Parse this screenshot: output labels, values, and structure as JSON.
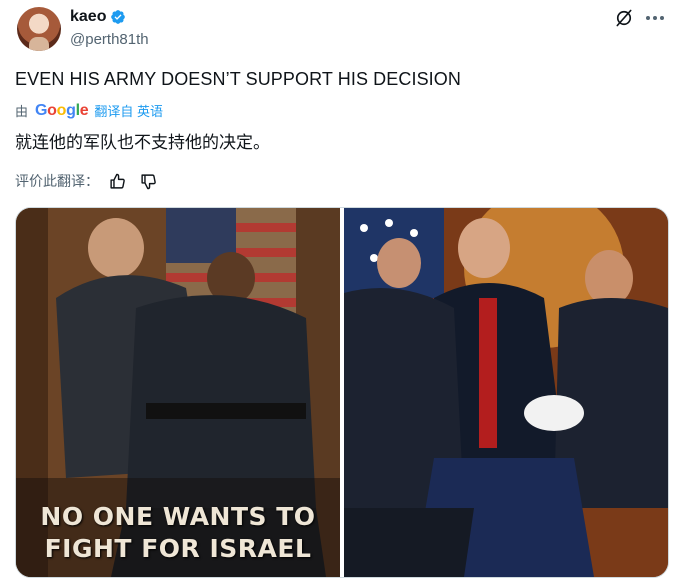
{
  "post": {
    "display_name": "kaeo",
    "handle": "@perth81th",
    "text": "EVEN HIS ARMY DOESN’T SUPPORT HIS DECISION",
    "translated_by_prefix": "由",
    "google_logo": "Google",
    "translated_by_suffix": "翻译自 英语",
    "translated_text": "就连他的军队也不支持他的决定。",
    "rate_label": "评价此翻译："
  },
  "media": {
    "left_caption_line1": "NO ONE WANTS TO",
    "left_caption_line2": "FIGHT FOR ISRAEL"
  },
  "colors": {
    "accent": "#1d9bf0",
    "secondary_text": "#536471",
    "verified": "#1d9bf0"
  },
  "icons": [
    "verified-badge-icon",
    "grok-icon",
    "more-icon",
    "thumbs-up-icon",
    "thumbs-down-icon"
  ]
}
